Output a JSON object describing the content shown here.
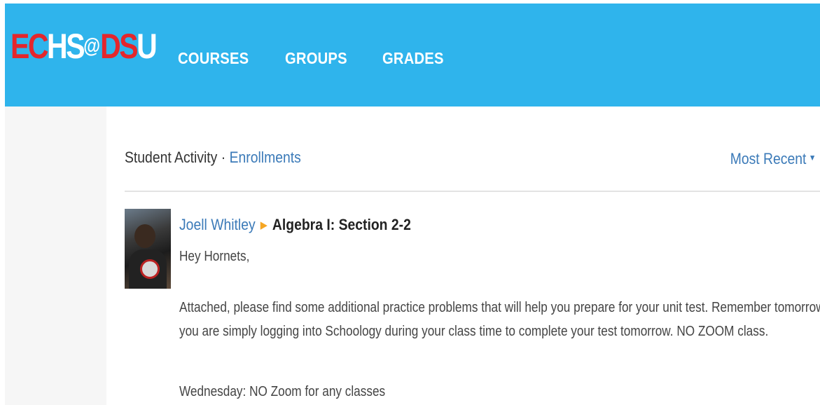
{
  "header": {
    "logo": {
      "part1": "EC",
      "part2": "HS",
      "at": "@",
      "part3": "DS",
      "part4": "U"
    },
    "nav": [
      "COURSES",
      "GROUPS",
      "GRADES"
    ],
    "colors": {
      "bar": "#2fb4ec",
      "logo_red": "#e4262c"
    }
  },
  "activity": {
    "title": "Student Activity ·",
    "enrollments_link": "Enrollments",
    "sort_label": "Most Recent",
    "sort_icon": "caret-down-icon"
  },
  "post": {
    "author": "Joell Whitley",
    "separator_icon": "triangle-right-icon",
    "course": "Algebra I: Section 2-2",
    "greeting": "Hey Hornets,",
    "paragraph_line1": "Attached, please find some additional practice problems that will help you prepare for your unit test. Remember tomorrow",
    "paragraph_line2": "you are simply logging into Schoology during your class time to complete your test tomorrow. NO ZOOM class.",
    "note": "Wednesday: NO Zoom for any classes"
  }
}
